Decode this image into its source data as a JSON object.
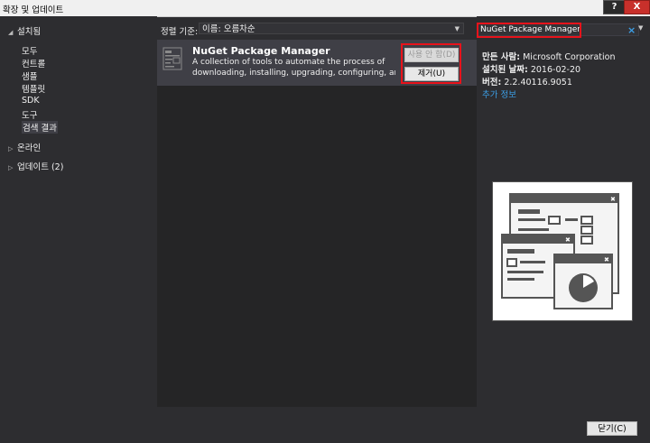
{
  "window": {
    "title": "확장 및 업데이트",
    "help_label": "?",
    "close_label": "X"
  },
  "nav": {
    "installed": "설치됨",
    "installed_items": [
      "모두",
      "컨트롤",
      "샘플",
      "템플릿",
      "SDK",
      "도구",
      "검색 결과"
    ],
    "online": "온라인",
    "updates": "업데이트 (2)"
  },
  "sort": {
    "label": "정렬 기준:",
    "value": "이름: 오름차순"
  },
  "extension": {
    "name": "NuGet Package Manager",
    "description_line1": "A collection of tools to automate the process of",
    "description_line2": "downloading, installing, upgrading, configuring, and...",
    "disable_label": "사용 안 함(D)",
    "remove_label": "제거(U)"
  },
  "search": {
    "value": "NuGet Package Manager",
    "clear_icon": "×"
  },
  "details": {
    "author_label": "만든 사람:",
    "author": "Microsoft Corporation",
    "date_label": "설치된 날짜:",
    "date": "2016-02-20",
    "version_label": "버전:",
    "version": "2.2.40116.9051",
    "more_info": "추가 정보"
  },
  "footer": {
    "close_label": "닫기(C)"
  },
  "colors": {
    "accent_link": "#3ca0e8",
    "highlight_box": "#e8131b",
    "selected_row": "#3f3f46"
  }
}
